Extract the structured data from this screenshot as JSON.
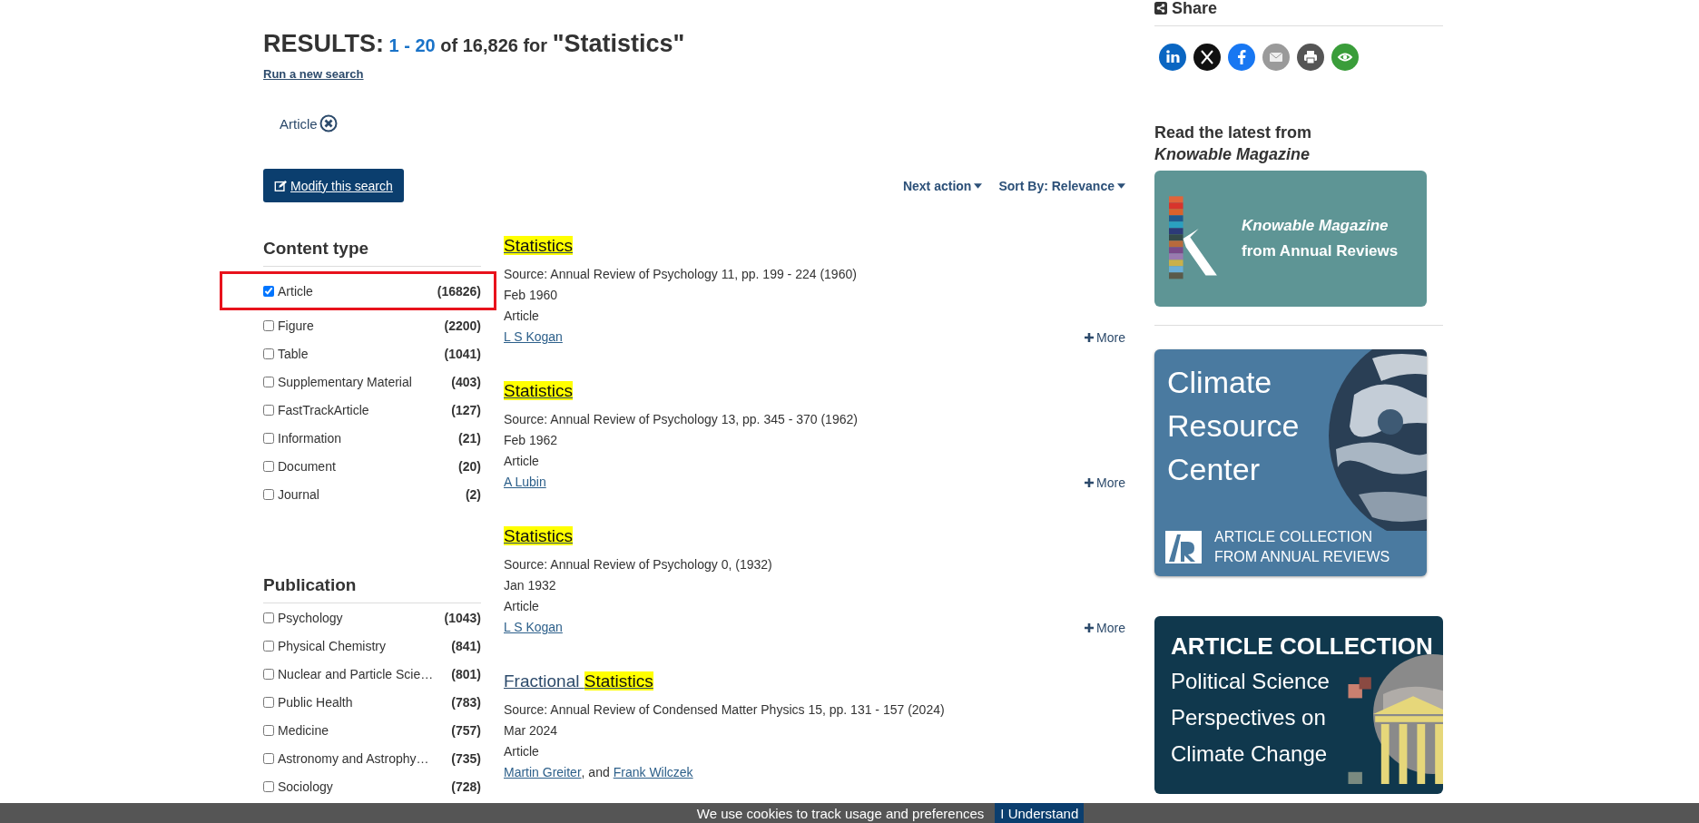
{
  "heading": {
    "label": "RESULTS:",
    "range": "1 - 20",
    "rest": "of 16,826 for",
    "query": "\"Statistics\""
  },
  "new_search_link": "Run a new search",
  "active_filters": [
    {
      "label": "Article"
    }
  ],
  "modify_button": "Modify this search",
  "toolbar": [
    {
      "label": "Next action"
    },
    {
      "label": "Sort By: Relevance"
    }
  ],
  "facets": [
    {
      "title": "Content type",
      "items": [
        {
          "label": "Article",
          "count": "(16826)",
          "checked": true,
          "highlighted": true
        },
        {
          "label": "Figure",
          "count": "(2200)",
          "checked": false,
          "highlighted": false
        },
        {
          "label": "Table",
          "count": "(1041)",
          "checked": false,
          "highlighted": false
        },
        {
          "label": "Supplementary Material",
          "count": "(403)",
          "checked": false,
          "highlighted": false
        },
        {
          "label": "FastTrackArticle",
          "count": "(127)",
          "checked": false,
          "highlighted": false
        },
        {
          "label": "Information",
          "count": "(21)",
          "checked": false,
          "highlighted": false
        },
        {
          "label": "Document",
          "count": "(20)",
          "checked": false,
          "highlighted": false
        },
        {
          "label": "Journal",
          "count": "(2)",
          "checked": false,
          "highlighted": false
        }
      ]
    },
    {
      "title": "Publication",
      "items": [
        {
          "label": "Psychology",
          "count": "(1043)",
          "checked": false,
          "highlighted": false
        },
        {
          "label": "Physical Chemistry",
          "count": "(841)",
          "checked": false,
          "highlighted": false
        },
        {
          "label": "Nuclear and Particle Scie…",
          "count": "(801)",
          "checked": false,
          "highlighted": false
        },
        {
          "label": "Public Health",
          "count": "(783)",
          "checked": false,
          "highlighted": false
        },
        {
          "label": "Medicine",
          "count": "(757)",
          "checked": false,
          "highlighted": false
        },
        {
          "label": "Astronomy and Astrophy…",
          "count": "(735)",
          "checked": false,
          "highlighted": false
        },
        {
          "label": "Sociology",
          "count": "(728)",
          "checked": false,
          "highlighted": false
        }
      ]
    }
  ],
  "results": [
    {
      "title": [
        {
          "text": "Statistics",
          "highlighted": true
        }
      ],
      "source": "Source: Annual Review of Psychology 11, pp. 199 - 224 (1960)",
      "date": "Feb 1960",
      "type": "Article",
      "authors": [
        "L S Kogan"
      ],
      "more": "More"
    },
    {
      "title": [
        {
          "text": "Statistics",
          "highlighted": true
        }
      ],
      "source": "Source: Annual Review of Psychology 13, pp. 345 - 370 (1962)",
      "date": "Feb 1962",
      "type": "Article",
      "authors": [
        "A Lubin"
      ],
      "more": "More"
    },
    {
      "title": [
        {
          "text": "Statistics",
          "highlighted": true
        }
      ],
      "source": "Source: Annual Review of Psychology 0, (1932)",
      "date": "Jan 1932",
      "type": "Article",
      "authors": [
        "L S Kogan"
      ],
      "more": "More"
    },
    {
      "title": [
        {
          "text": "Fractional ",
          "highlighted": false
        },
        {
          "text": "Statistics",
          "highlighted": true
        }
      ],
      "source": "Source: Annual Review of Condensed Matter Physics 15, pp. 131 - 157 (2024)",
      "date": "Mar 2024",
      "type": "Article",
      "authors": [
        "Martin Greiter",
        "Frank Wilczek"
      ],
      "author_joiner": ", and"
    }
  ],
  "share": {
    "title": "Share"
  },
  "knowable": {
    "heading": "Read the latest from",
    "heading_italic": "Knowable Magazine",
    "banner_line_1": "Knowable Magazine",
    "banner_line_2": "from Annual Reviews"
  },
  "climate_banner": {
    "lines": [
      "Climate",
      "Resource",
      "Center"
    ],
    "footer_lines": [
      "ARTICLE COLLECTION",
      "FROM ANNUAL REVIEWS"
    ]
  },
  "collection_banner": {
    "title": "ARTICLE COLLECTION",
    "lines": [
      "Political Science",
      "Perspectives on",
      "Climate Change"
    ]
  },
  "cookie_bar": {
    "message": "We use cookies to track usage and preferences",
    "button": "I Understand"
  }
}
